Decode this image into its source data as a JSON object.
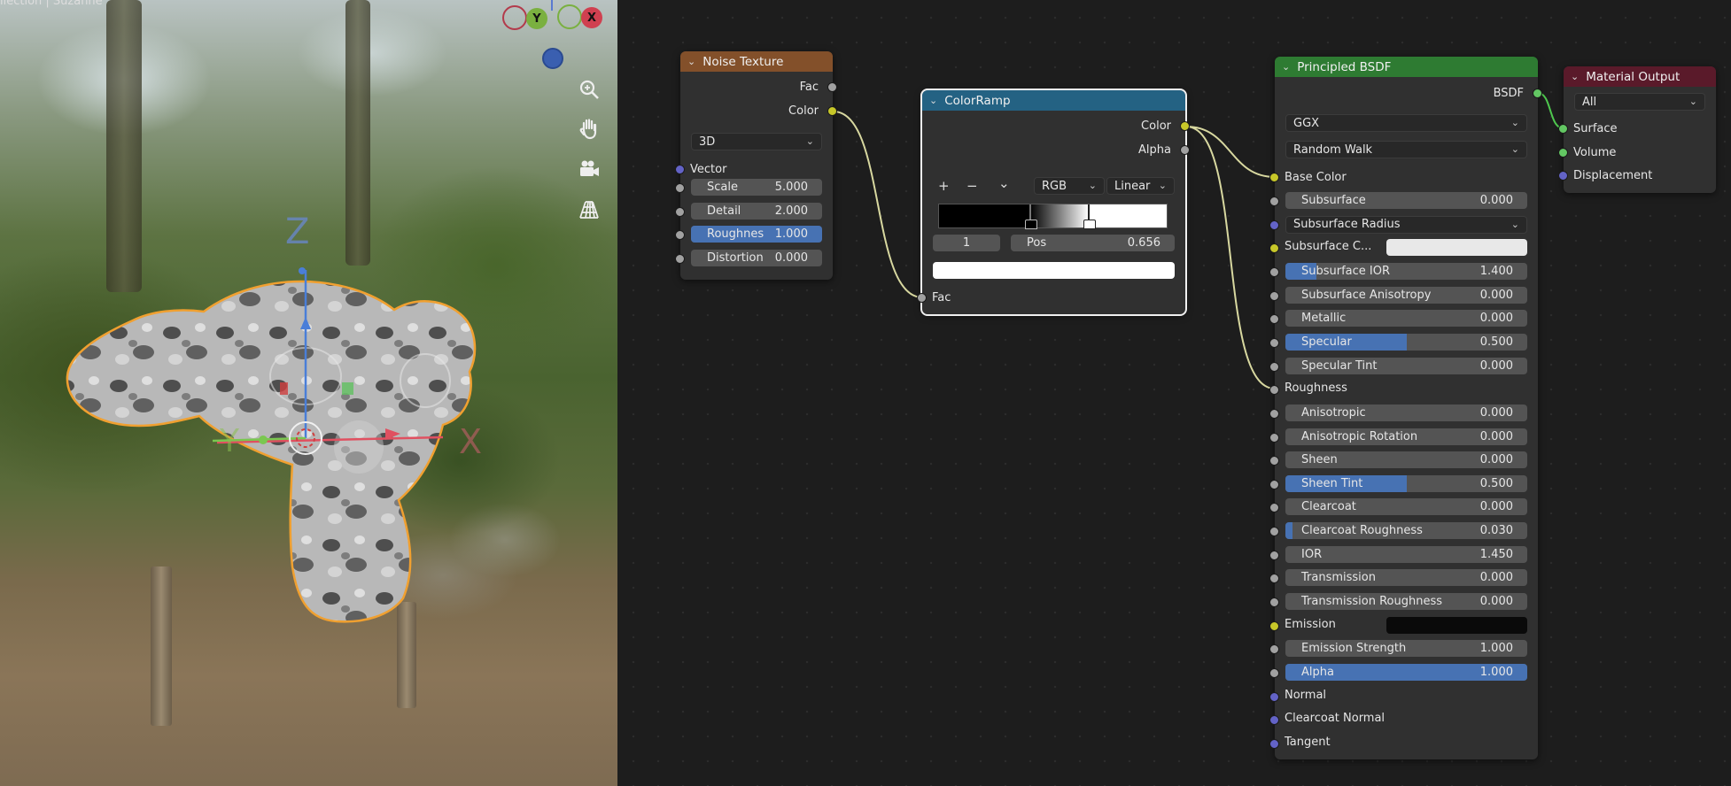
{
  "viewport": {
    "title": "llection | Suzanne",
    "gizmo": {
      "y_label": "Y",
      "x_label": "X"
    },
    "axis_labels": {
      "z": "Z",
      "x": "X",
      "y": "Y"
    },
    "tools": [
      "zoom-icon",
      "hand-pan-icon",
      "camera-icon",
      "grid-icon"
    ]
  },
  "colors": {
    "noise_header": "#83502a",
    "colorramp_header": "#246283",
    "bsdf_header": "#2e7b32",
    "output_header": "#5a1a2a",
    "slider_fill": "#4772b3",
    "link": "#d8d8a0",
    "selection": "#f0a030"
  },
  "noise": {
    "title": "Noise Texture",
    "out_fac": "Fac",
    "out_color": "Color",
    "dimensions": "3D",
    "in_vector": "Vector",
    "fields": [
      {
        "label": "Scale",
        "value": "5.000",
        "fill": 0
      },
      {
        "label": "Detail",
        "value": "2.000",
        "fill": 0
      },
      {
        "label": "Roughnes",
        "value": "1.000",
        "fill": 1
      },
      {
        "label": "Distortion",
        "value": "0.000",
        "fill": 0
      }
    ]
  },
  "colorramp": {
    "title": "ColorRamp",
    "out_color": "Color",
    "out_alpha": "Alpha",
    "add_label": "+",
    "remove_label": "−",
    "menu_label": "⌄",
    "color_mode": "RGB",
    "interpolation": "Linear",
    "stop_index": "1",
    "pos_label": "Pos",
    "pos_value": "0.656",
    "stop_positions": [
      0.4,
      0.656
    ],
    "in_fac": "Fac"
  },
  "bsdf": {
    "title": "Principled BSDF",
    "out_bsdf": "BSDF",
    "distribution": "GGX",
    "subsurface_method": "Random Walk",
    "base_color": "Base Color",
    "rows": [
      {
        "kind": "slider",
        "label": "Subsurface",
        "value": "0.000",
        "fill": 0,
        "sock": "gray"
      },
      {
        "kind": "dropdown",
        "label": "Subsurface Radius",
        "sock": "blue"
      },
      {
        "kind": "color",
        "label": "Subsurface C...",
        "swatch": "#e8e8e8",
        "sock": "yellow"
      },
      {
        "kind": "slider",
        "label": "Subsurface IOR",
        "value": "1.400",
        "fill": 0.13,
        "sock": "gray"
      },
      {
        "kind": "slider",
        "label": "Subsurface Anisotropy",
        "value": "0.000",
        "fill": 0,
        "sock": "gray"
      },
      {
        "kind": "slider",
        "label": "Metallic",
        "value": "0.000",
        "fill": 0,
        "sock": "gray"
      },
      {
        "kind": "slider",
        "label": "Specular",
        "value": "0.500",
        "fill": 0.5,
        "sock": "gray"
      },
      {
        "kind": "slider",
        "label": "Specular Tint",
        "value": "0.000",
        "fill": 0,
        "sock": "gray"
      },
      {
        "kind": "label",
        "label": "Roughness",
        "sock": "gray"
      },
      {
        "kind": "slider",
        "label": "Anisotropic",
        "value": "0.000",
        "fill": 0,
        "sock": "gray"
      },
      {
        "kind": "slider",
        "label": "Anisotropic Rotation",
        "value": "0.000",
        "fill": 0,
        "sock": "gray"
      },
      {
        "kind": "slider",
        "label": "Sheen",
        "value": "0.000",
        "fill": 0,
        "sock": "gray"
      },
      {
        "kind": "slider",
        "label": "Sheen Tint",
        "value": "0.500",
        "fill": 0.5,
        "sock": "gray"
      },
      {
        "kind": "slider",
        "label": "Clearcoat",
        "value": "0.000",
        "fill": 0,
        "sock": "gray"
      },
      {
        "kind": "slider",
        "label": "Clearcoat Roughness",
        "value": "0.030",
        "fill": 0.03,
        "sock": "gray"
      },
      {
        "kind": "slider",
        "label": "IOR",
        "value": "1.450",
        "fill": 0,
        "sock": "gray"
      },
      {
        "kind": "slider",
        "label": "Transmission",
        "value": "0.000",
        "fill": 0,
        "sock": "gray"
      },
      {
        "kind": "slider",
        "label": "Transmission Roughness",
        "value": "0.000",
        "fill": 0,
        "sock": "gray"
      },
      {
        "kind": "color",
        "label": "Emission",
        "swatch": "#0a0a0a",
        "sock": "yellow"
      },
      {
        "kind": "slider",
        "label": "Emission Strength",
        "value": "1.000",
        "fill": 0,
        "sock": "gray"
      },
      {
        "kind": "slider",
        "label": "Alpha",
        "value": "1.000",
        "fill": 1,
        "sock": "gray"
      },
      {
        "kind": "label",
        "label": "Normal",
        "sock": "blue"
      },
      {
        "kind": "label",
        "label": "Clearcoat Normal",
        "sock": "blue"
      },
      {
        "kind": "label",
        "label": "Tangent",
        "sock": "blue"
      }
    ]
  },
  "output": {
    "title": "Material Output",
    "target": "All",
    "in_surface": "Surface",
    "in_volume": "Volume",
    "in_displacement": "Displacement"
  }
}
